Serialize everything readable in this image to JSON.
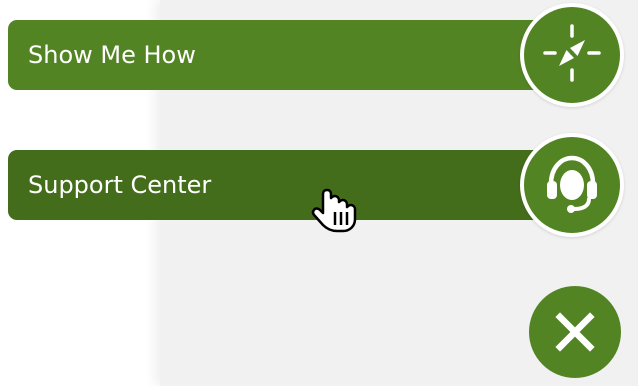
{
  "menu": {
    "items": [
      {
        "label": "Show Me How",
        "icon": "compass-icon"
      },
      {
        "label": "Support Center",
        "icon": "headset-icon"
      }
    ],
    "close_icon": "close-icon"
  },
  "colors": {
    "accent_green": "#538424",
    "hover_green": "#446d1b",
    "panel_gray": "#f1f1f1",
    "white": "#ffffff"
  }
}
